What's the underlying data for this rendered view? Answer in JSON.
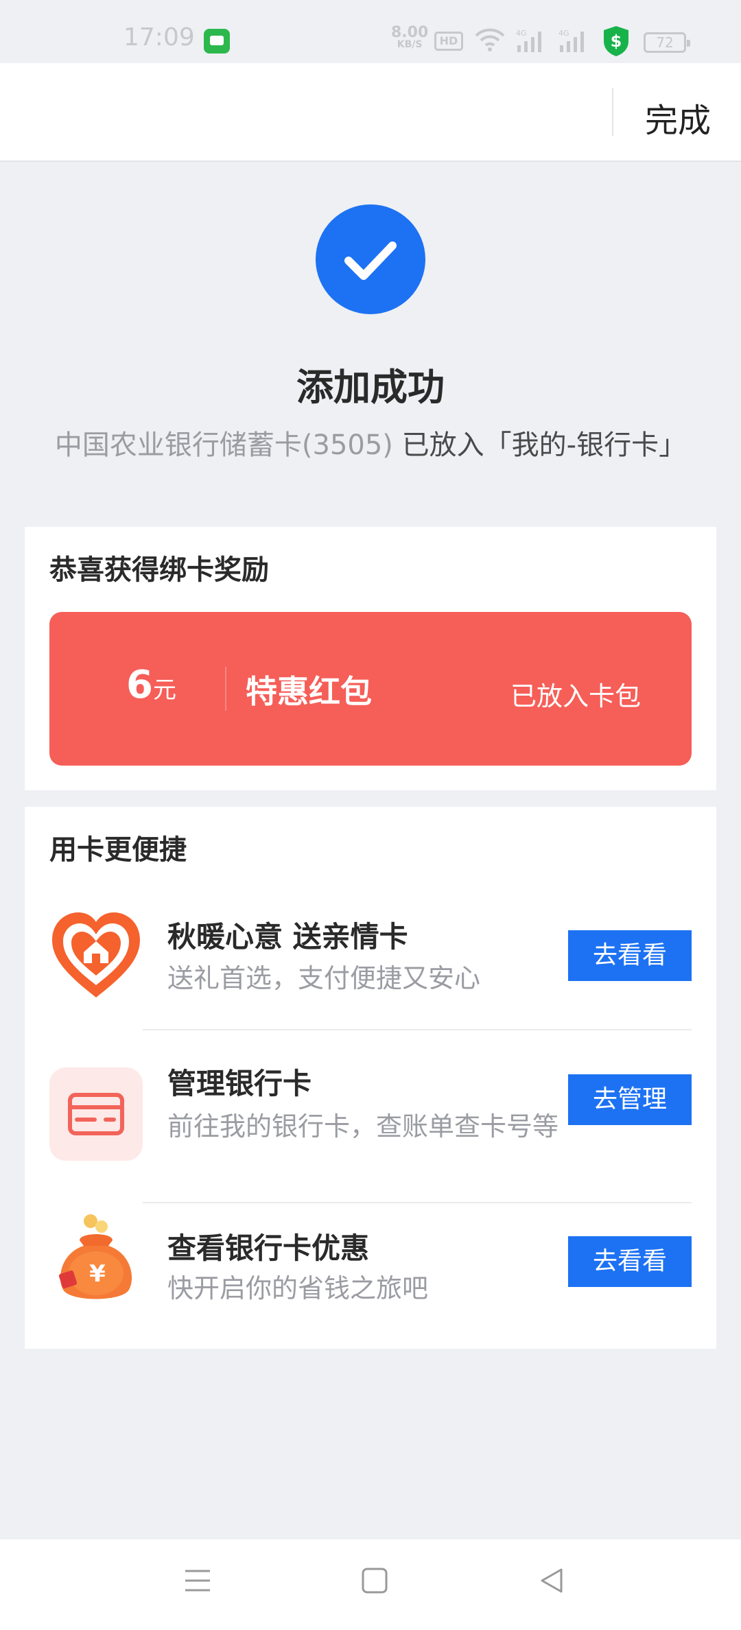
{
  "status_bar": {
    "time": "17:09",
    "net_speed_value": "8.00",
    "net_speed_unit": "KB/S",
    "hd_label": "HD",
    "signal_label": "4G",
    "battery_level": "72"
  },
  "header": {
    "done_label": "完成"
  },
  "success": {
    "title": "添加成功",
    "card_name": "中国农业银行储蓄卡(3505) ",
    "destination": "已放入「我的-银行卡」"
  },
  "reward_card": {
    "title": "恭喜获得绑卡奖励",
    "amount": "6",
    "unit": "元",
    "name": "特惠红包",
    "status": "已放入卡包"
  },
  "features_card": {
    "title": "用卡更便捷",
    "items": [
      {
        "icon": "heart-home-icon",
        "title": "秋暖心意 送亲情卡",
        "subtitle": "送礼首选，支付便捷又安心",
        "button": "去看看"
      },
      {
        "icon": "bank-card-icon",
        "title": "管理银行卡",
        "subtitle": "前往我的银行卡，查账单查卡号等",
        "button": "去管理"
      },
      {
        "icon": "money-bag-icon",
        "title": "查看银行卡优惠",
        "subtitle": "快开启你的省钱之旅吧",
        "button": "去看看"
      }
    ]
  },
  "colors": {
    "accent_blue": "#1d72f3",
    "reward_red": "#f65e58",
    "background": "#eef0f4"
  }
}
